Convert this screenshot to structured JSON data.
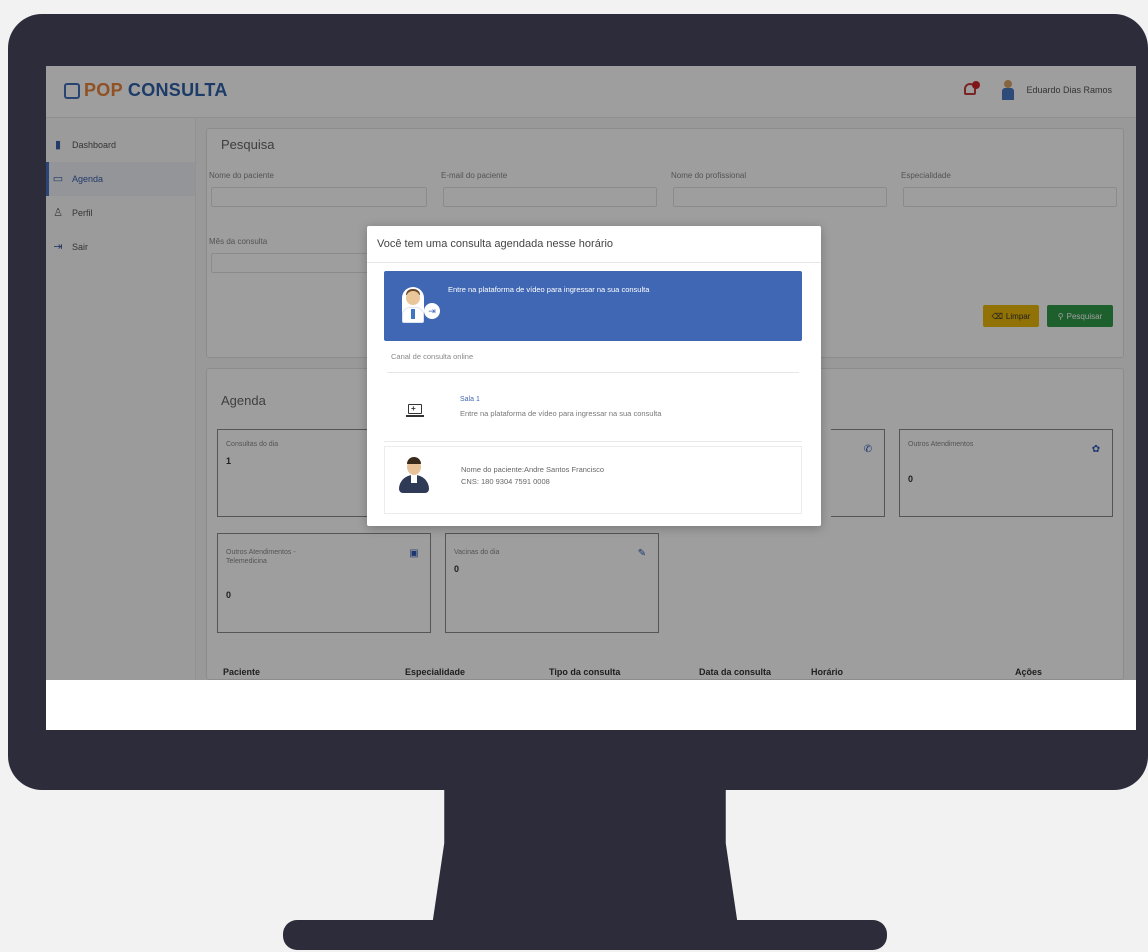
{
  "app": {
    "logo_text_pop": "POP",
    "logo_text_rest": " CONSULTA",
    "user_name": "Eduardo Dias Ramos"
  },
  "sidebar": {
    "items": [
      {
        "label": "Dashboard",
        "icon": "bar-chart-icon"
      },
      {
        "label": "Agenda",
        "icon": "calendar-icon"
      },
      {
        "label": "Perfil",
        "icon": "user-icon"
      },
      {
        "label": "Sair",
        "icon": "logout-icon"
      }
    ]
  },
  "search": {
    "title": "Pesquisa",
    "fields": [
      {
        "label": "Nome do paciente"
      },
      {
        "label": "E-mail do paciente"
      },
      {
        "label": "Nome do profissional"
      },
      {
        "label": "Especialidade"
      },
      {
        "label": "Mês da consulta"
      }
    ],
    "clear_label": "Limpar",
    "search_label": "Pesquisar"
  },
  "agenda": {
    "title": "Agenda",
    "stats": [
      {
        "label": "Consultas do dia",
        "value": "1"
      },
      {
        "label": "Outros Atendimentos",
        "value": "0"
      },
      {
        "label": "Outros Atendimentos - Telemedicina",
        "value": "0"
      },
      {
        "label": "Vacinas do dia",
        "value": "0"
      }
    ],
    "table_headers": [
      "Paciente",
      "Especialidade",
      "Tipo da consulta",
      "Data da consulta",
      "Horário",
      "Ações"
    ]
  },
  "modal": {
    "title": "Você tem uma consulta agendada nesse horário",
    "banner_text": "Entre na plataforma de vídeo para ingressar na sua consulta",
    "channel_label": "Canal de consulta online",
    "room_name": "Sala 1",
    "room_desc": "Entre na plataforma de vídeo para ingressar na sua consulta",
    "patient_name": "Nome do paciente:Andre Santos Francisco",
    "patient_cns": "CNS: 180 9304 7591 0008"
  },
  "colors": {
    "monitor": "#2d2c3b",
    "brand_blue": "#4067b4",
    "brand_orange": "#e8833a",
    "clear_button": "#e8b80a",
    "search_button": "#2f9a49"
  }
}
